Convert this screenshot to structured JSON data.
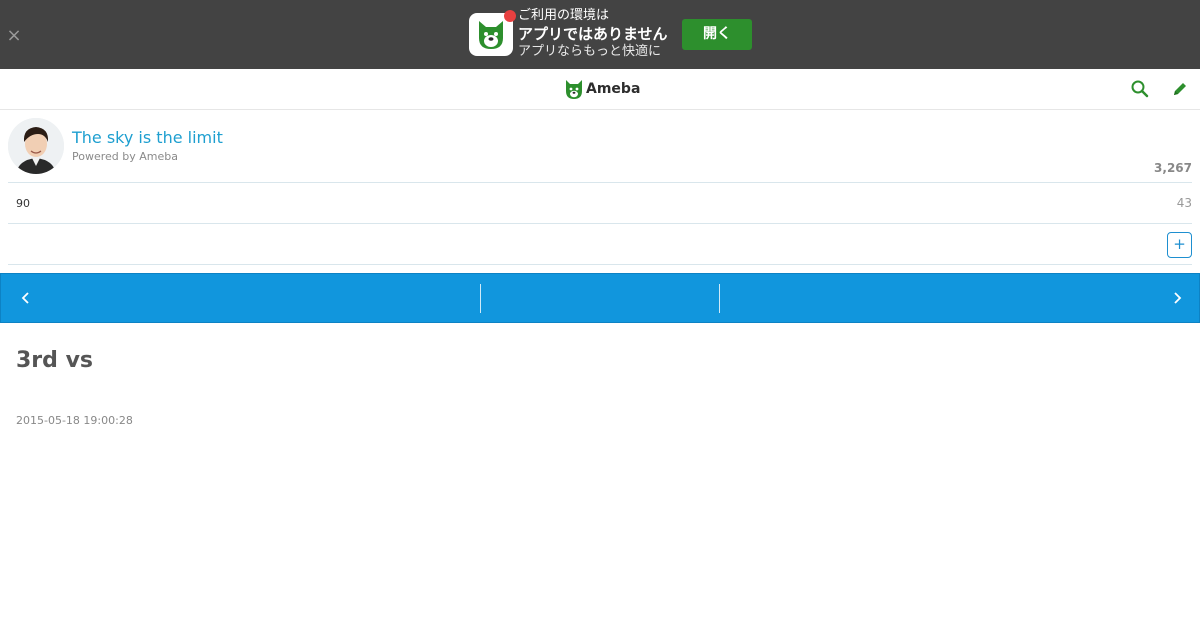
{
  "app_banner": {
    "close_glyph": "×",
    "icon": "ameba-app-icon",
    "line1": "ご利用の環境は",
    "line2": "アプリではありません",
    "line3": "アプリならもっと快適に",
    "open_label": "開く",
    "background": "#434343",
    "button_color": "#2d8f2d",
    "badge_color": "#e84040"
  },
  "header": {
    "logo_text": "Ameba",
    "search_icon": "search-icon",
    "edit_icon": "edit-pencil-icon",
    "accent": "#2d8f2d"
  },
  "profile": {
    "blog_title": "The sky is the limit",
    "powered_by": "Powered by Ameba",
    "count_right": "3,267",
    "title_color": "#1e9fd0"
  },
  "stats": {
    "left": "90",
    "right": "43"
  },
  "actions": {
    "plus_label": "+"
  },
  "blue_nav": {
    "color": "#1196dd",
    "prev_icon": "chevron-left-icon",
    "next_icon": "chevron-right-icon"
  },
  "article": {
    "title": "3rd vs",
    "date": "2015-05-18 19:00:28"
  }
}
